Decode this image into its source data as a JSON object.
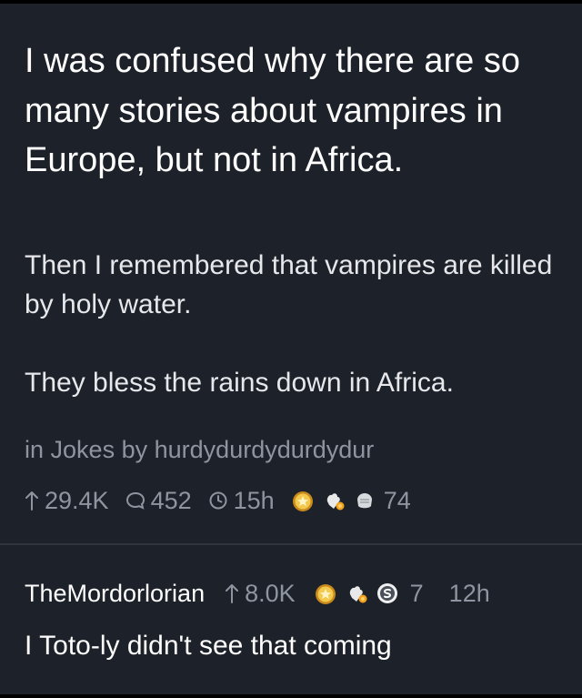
{
  "post": {
    "title": "I was confused why there are so many stories about vampires in Europe, but not in Africa.",
    "body": [
      "Then I remembered that vampires are killed by holy water.",
      "They bless the rains down in Africa."
    ],
    "in_label": "in",
    "subreddit": "Jokes",
    "by_label": "by",
    "author": "hurdydurdydurdydur",
    "score": "29.4K",
    "comments": "452",
    "age": "15h",
    "awards_count": "74"
  },
  "comment": {
    "author": "TheMordorlorian",
    "score": "8.0K",
    "awards_count": "7",
    "age": "12h",
    "body": "I Toto-ly didn't see that coming"
  },
  "colors": {
    "background": "#1d2129",
    "text": "#ffffff",
    "muted": "#8f95a0",
    "award_gold": "#e8b931",
    "award_silver": "#c9ccd1"
  }
}
